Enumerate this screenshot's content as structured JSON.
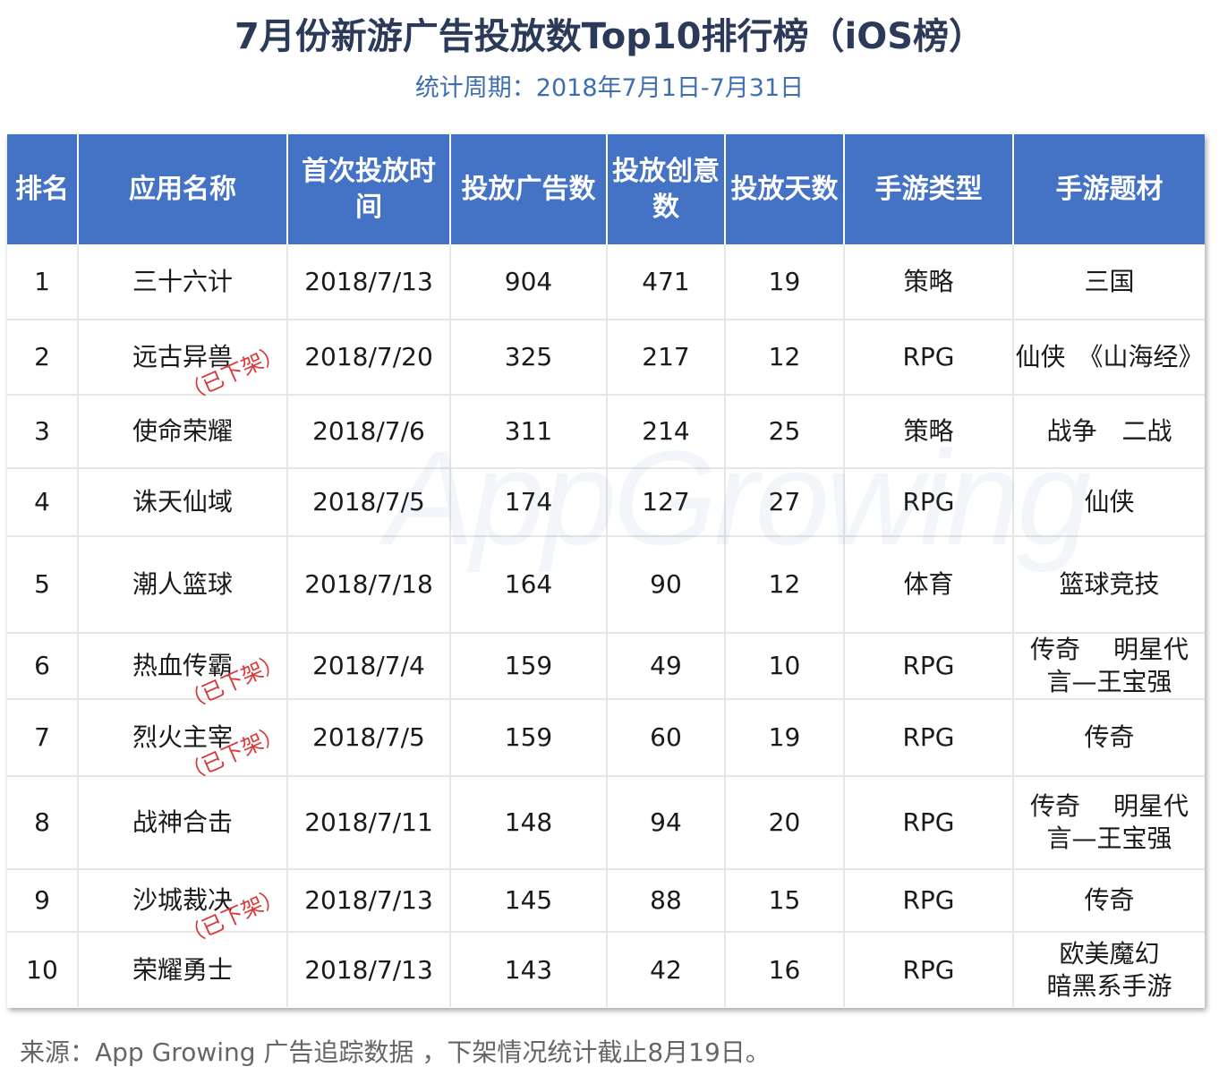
{
  "title": "7月份新游广告投放数Top10排行榜（iOS榜）",
  "subtitle": "统计周期：2018年7月1日-7月31日",
  "watermark": "AppGrowing",
  "headers": [
    "排名",
    "应用名称",
    "首次投放时间",
    "投放广告数",
    "投放创意数",
    "投放天数",
    "手游类型",
    "手游题材"
  ],
  "rows": [
    {
      "rank": "1",
      "name": "三十六计",
      "stamp": "",
      "date": "2018/7/13",
      "ads": "904",
      "creatives": "471",
      "days": "19",
      "type": "策略",
      "theme": "三国"
    },
    {
      "rank": "2",
      "name": "远古异兽",
      "stamp": "（已下架）",
      "date": "2018/7/20",
      "ads": "325",
      "creatives": "217",
      "days": "12",
      "type": "RPG",
      "theme": "仙侠　《山海经》"
    },
    {
      "rank": "3",
      "name": "使命荣耀",
      "stamp": "",
      "date": "2018/7/6",
      "ads": "311",
      "creatives": "214",
      "days": "25",
      "type": "策略",
      "theme": "战争　二战"
    },
    {
      "rank": "4",
      "name": "诛天仙域",
      "stamp": "",
      "date": "2018/7/5",
      "ads": "174",
      "creatives": "127",
      "days": "27",
      "type": "RPG",
      "theme": "仙侠"
    },
    {
      "rank": "5",
      "name": "潮人篮球",
      "stamp": "",
      "date": "2018/7/18",
      "ads": "164",
      "creatives": "90",
      "days": "12",
      "type": "体育",
      "theme": "篮球竞技"
    },
    {
      "rank": "6",
      "name": "热血传霸",
      "stamp": "（已下架）",
      "date": "2018/7/4",
      "ads": "159",
      "creatives": "49",
      "days": "10",
      "type": "RPG",
      "theme": "传奇　 明星代\n言—王宝强"
    },
    {
      "rank": "7",
      "name": "烈火主宰",
      "stamp": "（已下架）",
      "date": "2018/7/5",
      "ads": "159",
      "creatives": "60",
      "days": "19",
      "type": "RPG",
      "theme": "传奇"
    },
    {
      "rank": "8",
      "name": "战神合击",
      "stamp": "",
      "date": "2018/7/11",
      "ads": "148",
      "creatives": "94",
      "days": "20",
      "type": "RPG",
      "theme": "传奇　 明星代\n言—王宝强"
    },
    {
      "rank": "9",
      "name": "沙城裁决",
      "stamp": "（已下架）",
      "date": "2018/7/13",
      "ads": "145",
      "creatives": "88",
      "days": "15",
      "type": "RPG",
      "theme": "传奇"
    },
    {
      "rank": "10",
      "name": "荣耀勇士",
      "stamp": "",
      "date": "2018/7/13",
      "ads": "143",
      "creatives": "42",
      "days": "16",
      "type": "RPG",
      "theme": "欧美魔幻\n暗黑系手游"
    }
  ],
  "footer": "来源：App Growing 广告追踪数据 ，下架情况统计截止8月19日。"
}
